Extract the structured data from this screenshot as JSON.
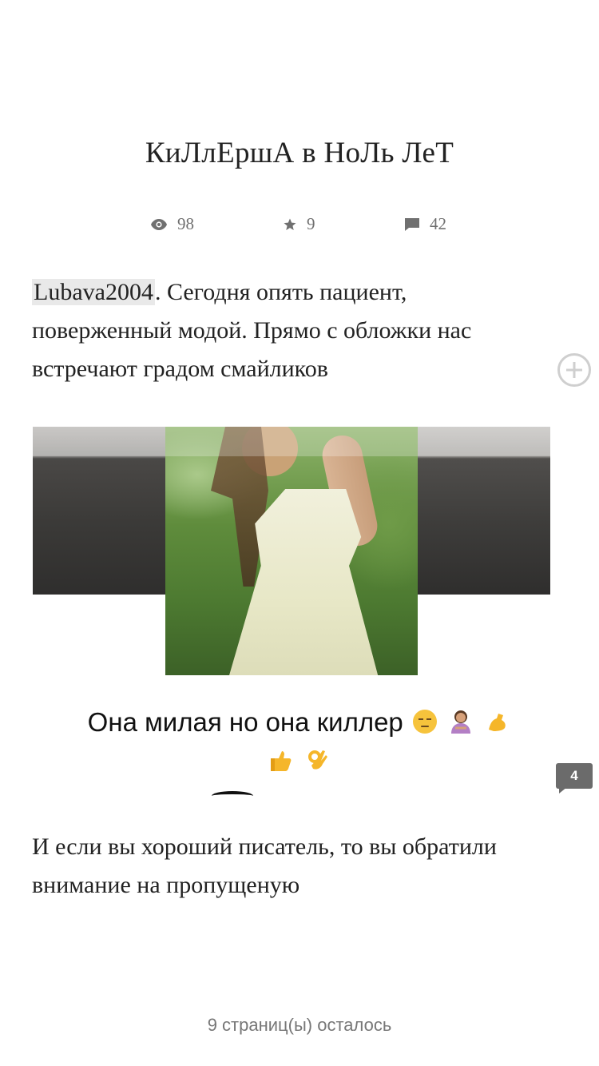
{
  "story": {
    "title": "КиЛлЕршА в НоЛь ЛеТ"
  },
  "stats": {
    "views": "98",
    "votes": "9",
    "comments": "42"
  },
  "body": {
    "mention": "Lubava2004",
    "paragraph1_rest": ". Сегодня опять пациент, поверженный модой. Прямо с обложки нас встречают градом смайликов",
    "caption_text": "Она милая но она киллер",
    "caption_emojis": [
      "unamused-face",
      "person-gesturing-no",
      "flexed-biceps",
      "thumbs-up",
      "ok-hand"
    ],
    "paragraph2": "И если вы хороший писатель, то вы обратили внимание на пропущеную"
  },
  "inline_comments": {
    "count": "4"
  },
  "footer": {
    "pages_left": "9 страниц(ы) осталось"
  },
  "icons": {
    "views": "eye-icon",
    "votes": "star-icon",
    "comments": "comment-icon",
    "add": "add-circle-icon"
  }
}
